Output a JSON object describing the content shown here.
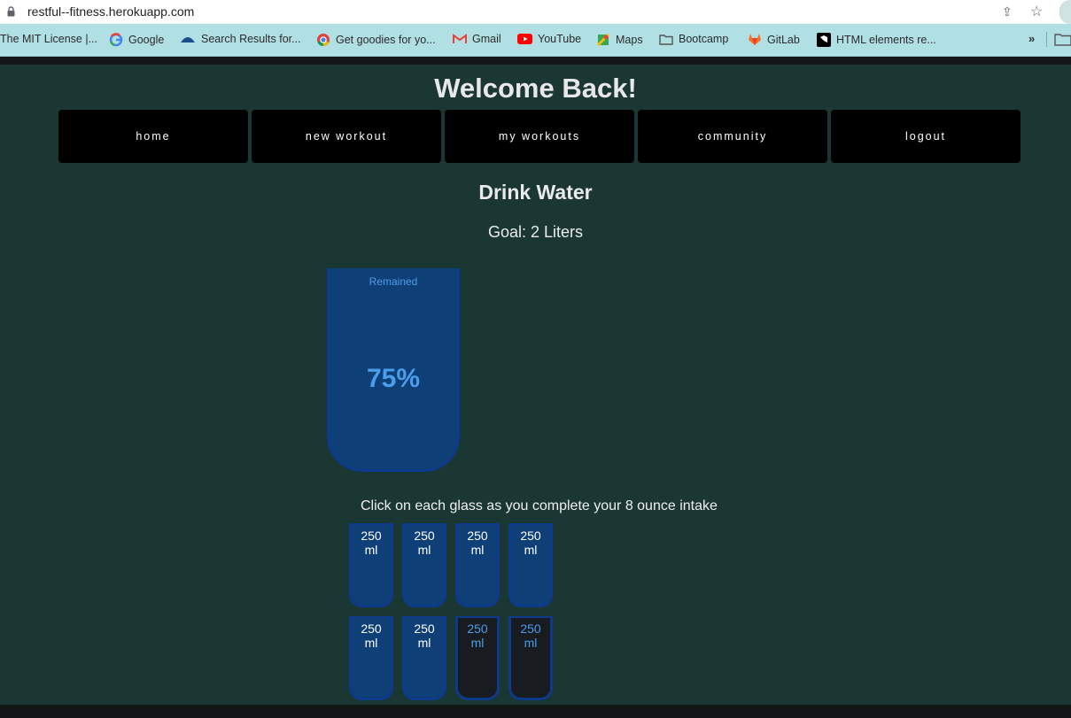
{
  "browser": {
    "url": "restful--fitness.herokuapp.com",
    "bookmarks": [
      {
        "label": "The MIT License |...",
        "icon": "license-icon"
      },
      {
        "label": "Google",
        "icon": "google-icon"
      },
      {
        "label": "Search Results for...",
        "icon": "search-results-icon"
      },
      {
        "label": "Get goodies for yo...",
        "icon": "chrome-icon"
      },
      {
        "label": "Gmail",
        "icon": "gmail-icon"
      },
      {
        "label": "YouTube",
        "icon": "youtube-icon"
      },
      {
        "label": "Maps",
        "icon": "maps-icon"
      },
      {
        "label": "Bootcamp",
        "icon": "folder-icon"
      },
      {
        "label": "GitLab",
        "icon": "gitlab-icon"
      },
      {
        "label": "HTML elements re...",
        "icon": "mdn-icon"
      }
    ],
    "more": "»"
  },
  "header": {
    "welcome": "Welcome Back!"
  },
  "nav": {
    "items": [
      {
        "label": "home"
      },
      {
        "label": "new workout"
      },
      {
        "label": "my workouts"
      },
      {
        "label": "community"
      },
      {
        "label": "logout"
      }
    ]
  },
  "water": {
    "title": "Drink Water",
    "goal": "Goal: 2 Liters",
    "remained_label": "Remained",
    "remained_percent": "75%",
    "instruction": "Click on each glass as you complete your 8 ounce intake",
    "cup_label_line1": "250",
    "cup_label_line2": "ml",
    "cups": [
      {
        "filled": true
      },
      {
        "filled": true
      },
      {
        "filled": true
      },
      {
        "filled": true
      },
      {
        "filled": true
      },
      {
        "filled": true
      },
      {
        "filled": false
      },
      {
        "filled": false
      }
    ]
  },
  "colors": {
    "background": "#1b3734",
    "nav_button": "#000000",
    "cup_filled": "#0f3f77",
    "cup_border": "#0d3a8a",
    "cup_empty": "#181b20",
    "accent_text": "#4a9de8"
  }
}
